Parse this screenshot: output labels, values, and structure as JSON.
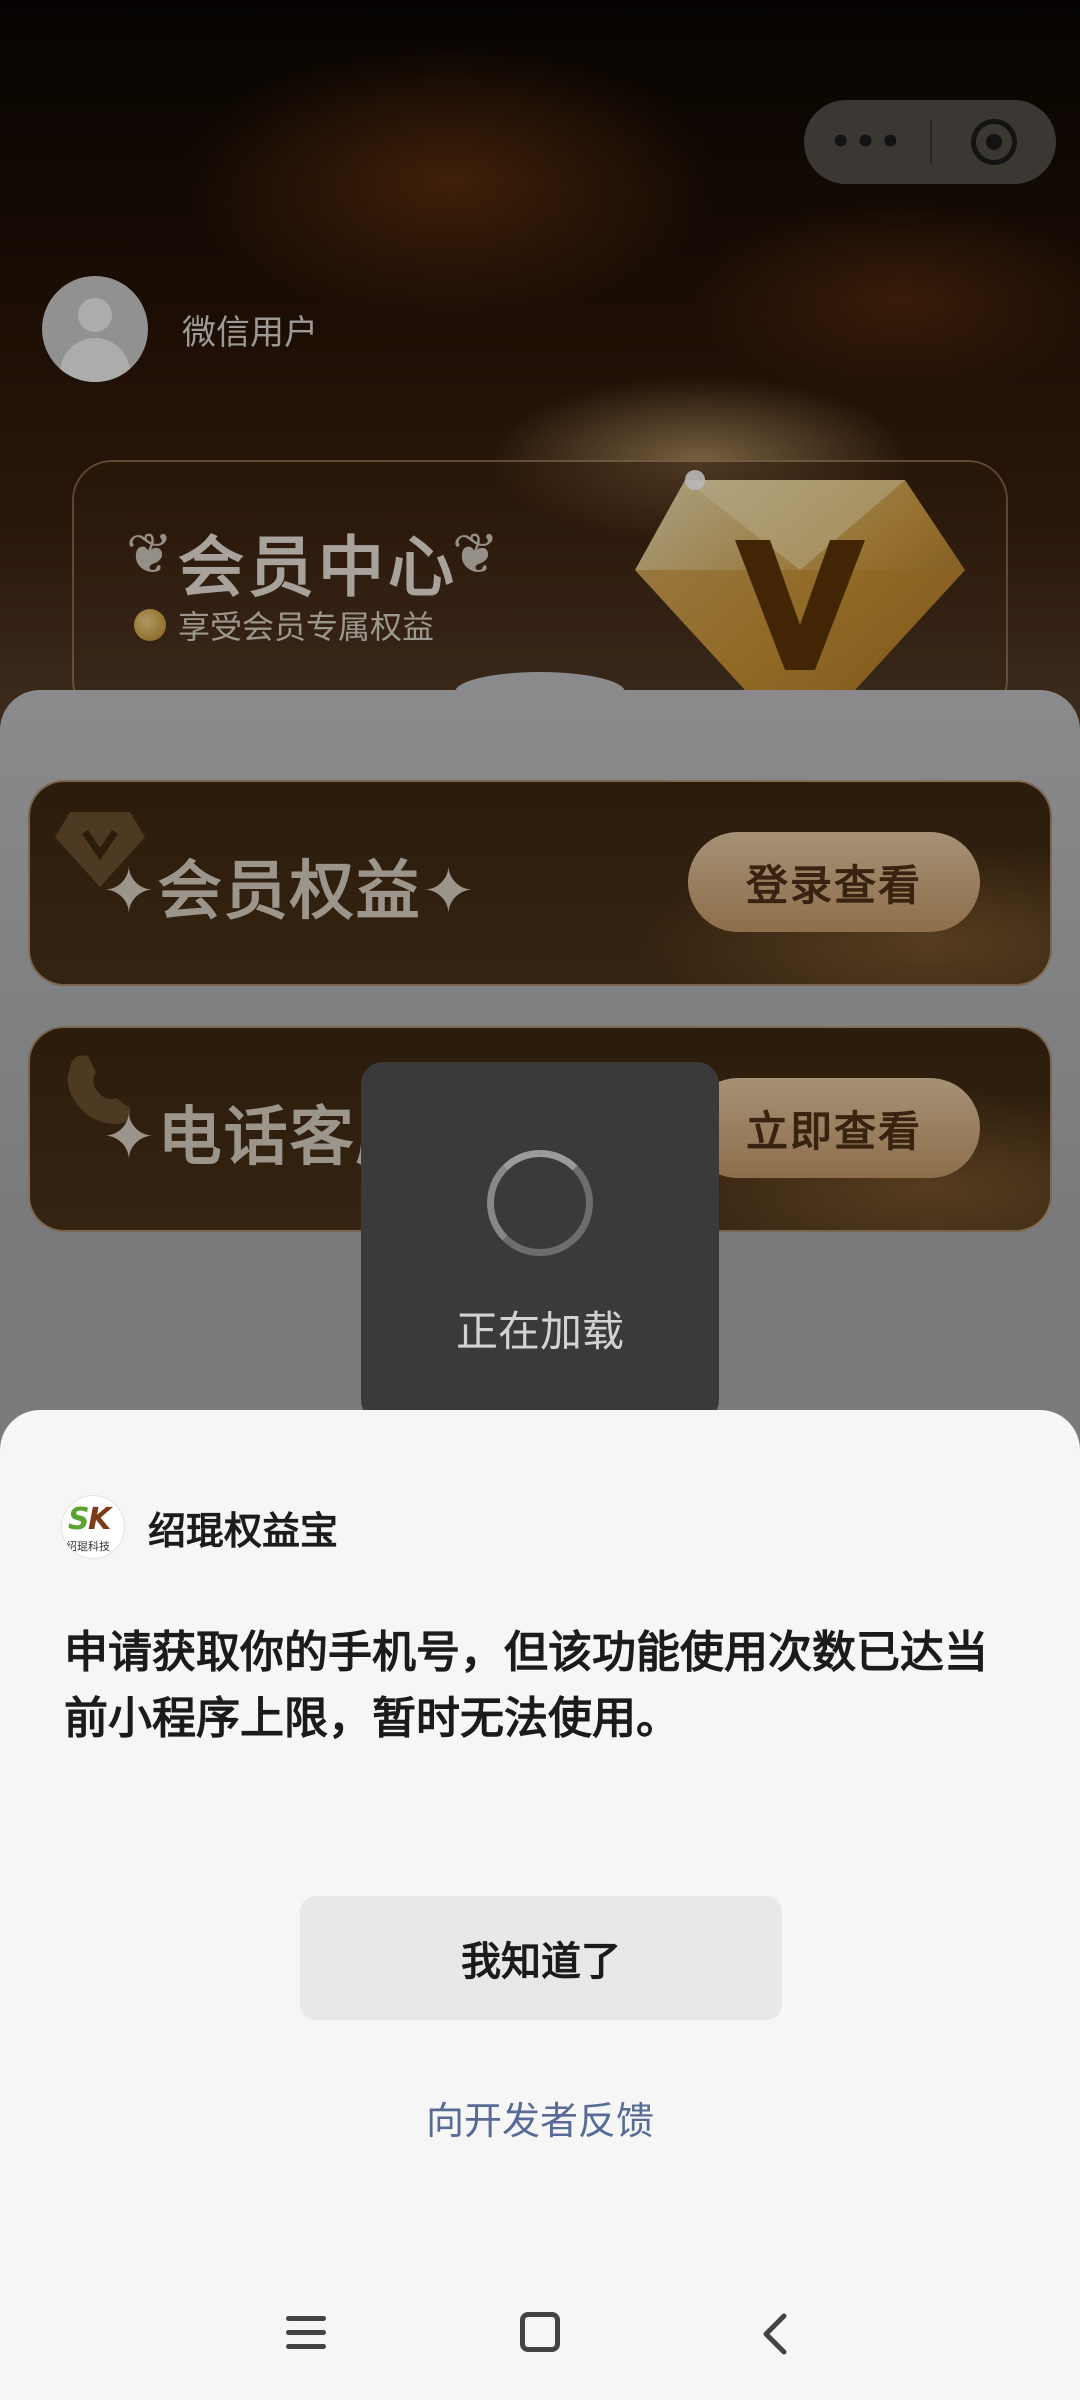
{
  "capsule": {
    "more_label": "•••"
  },
  "user": {
    "name": "微信用户"
  },
  "member_card": {
    "title": "会员中心",
    "subtitle": "享受会员专属权益"
  },
  "benefits": [
    {
      "label": "✦会员权益✦",
      "button": "登录查看"
    },
    {
      "label": "✦电话客服",
      "button": "立即查看"
    }
  ],
  "loading_toast": {
    "text": "正在加载"
  },
  "dialog": {
    "app_name": "绍琨权益宝",
    "logo_text": {
      "s": "S",
      "k": "K",
      "tiny": "绍琨科技"
    },
    "message": "申请获取你的手机号，但该功能使用次数已达当前小程序上限，暂时无法使用。",
    "ok_button": "我知道了",
    "feedback_link": "向开发者反馈"
  },
  "colors": {
    "brand_gold": "#c59a69",
    "link_blue": "#576b95",
    "sheet_bg": "#f6f6f6"
  },
  "icons": [
    "more-icon",
    "target-icon",
    "avatar-icon",
    "coin-icon",
    "diamond-v-icon",
    "phone-icon",
    "spinner-icon",
    "menu-icon",
    "home-icon",
    "back-icon"
  ]
}
